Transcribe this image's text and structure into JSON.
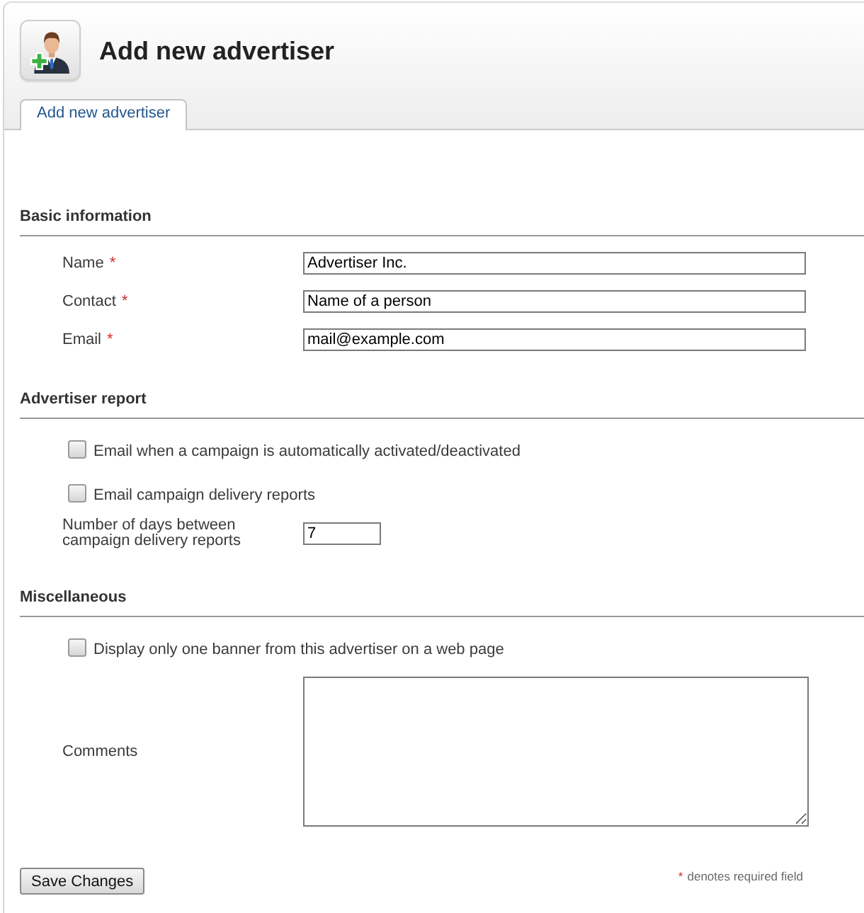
{
  "header": {
    "title": "Add new advertiser"
  },
  "tabs": [
    {
      "label": "Add new advertiser",
      "selected": true
    }
  ],
  "sections": [
    {
      "title": "Basic information",
      "rows": [
        {
          "kind": "text",
          "label": "Name",
          "required_mark": "*",
          "value": "Advertiser Inc."
        },
        {
          "kind": "text",
          "label": "Contact",
          "required_mark": "*",
          "value": "Name of a person"
        },
        {
          "kind": "text",
          "label": "Email",
          "required_mark": "*",
          "value": "mail@example.com"
        }
      ]
    },
    {
      "title": "Advertiser report",
      "rows": [
        {
          "kind": "checkbox",
          "label": "Email when a campaign is automatically activated/deactivated",
          "checked": false
        },
        {
          "kind": "checkbox",
          "label": "Email campaign delivery reports",
          "checked": false
        },
        {
          "kind": "number",
          "label": "Number of days between campaign delivery reports",
          "value": "7"
        }
      ]
    },
    {
      "title": "Miscellaneous",
      "rows": [
        {
          "kind": "checkbox",
          "label": "Display only one banner from this advertiser on a web page",
          "checked": false
        },
        {
          "kind": "textarea",
          "label": "Comments"
        }
      ]
    }
  ],
  "save_button": {
    "label": "Save Changes"
  },
  "required_note": {
    "mark": "*",
    "text": "denotes required field"
  }
}
